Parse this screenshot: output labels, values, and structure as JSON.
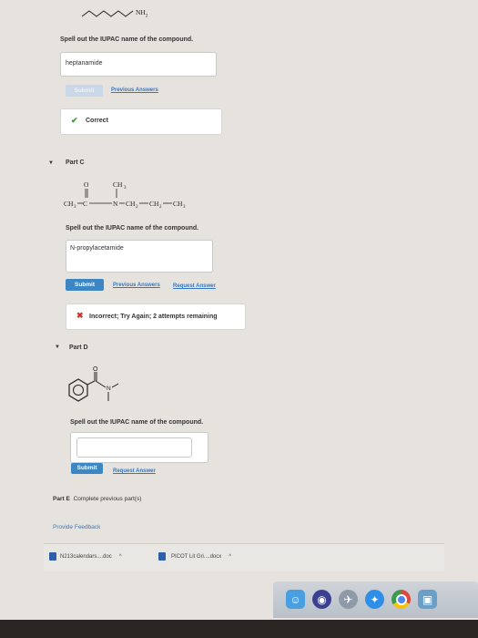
{
  "part_b": {
    "formula_text": "NH",
    "formula_sub": "2",
    "prompt": "Spell out the IUPAC name of the compound.",
    "answer_value": "heptanamide",
    "submit_label": "Submit",
    "previous_answers_label": "Previous Answers",
    "feedback_label": "Correct"
  },
  "part_c": {
    "title": "Part C",
    "prompt": "Spell out the IUPAC name of the compound.",
    "answer_value": "N-propylacetamide",
    "submit_label": "Submit",
    "previous_answers_label": "Previous Answers",
    "request_answer_label": "Request Answer",
    "feedback_label": "Incorrect; Try Again; 2 attempts remaining"
  },
  "part_d": {
    "title": "Part D",
    "prompt": "Spell out the IUPAC name of the compound.",
    "answer_value": "",
    "submit_label": "Submit",
    "request_answer_label": "Request Answer",
    "atom_o": "O",
    "atom_n": "N"
  },
  "part_e": {
    "label": "Part E",
    "text": "Complete previous part(s)"
  },
  "provide_feedback_label": "Provide Feedback",
  "downloads": [
    {
      "name": "N213calendars....doc",
      "icon": "word-doc-icon"
    },
    {
      "name": "PICOT Lit Gri....docx",
      "icon": "word-doc-icon"
    }
  ],
  "dock": [
    {
      "name": "finder-icon",
      "color": "#4a9fe0"
    },
    {
      "name": "siri-icon",
      "color": "#3b3f8f"
    },
    {
      "name": "launchpad-icon",
      "color": "#8e9aa8"
    },
    {
      "name": "safari-icon",
      "color": "#2f8fe6"
    },
    {
      "name": "chrome-icon",
      "color": "#e9e9e9"
    },
    {
      "name": "preview-icon",
      "color": "#6aa0c8"
    }
  ],
  "colors": {
    "accent": "#3c86c4",
    "correct": "#3a9b3a",
    "incorrect": "#d0312d",
    "background": "#e6e3de"
  }
}
